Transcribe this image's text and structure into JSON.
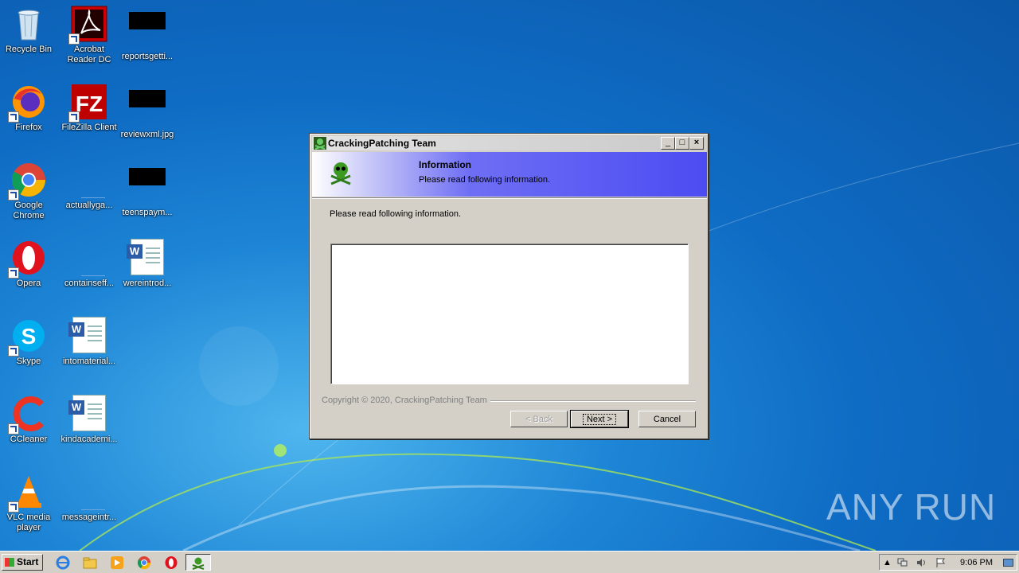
{
  "desktop": {
    "icons": [
      {
        "label": "Recycle Bin"
      },
      {
        "label": "Acrobat Reader DC"
      },
      {
        "label": "reportsgetti..."
      },
      {
        "label": "Firefox"
      },
      {
        "label": "FileZilla Client"
      },
      {
        "label": "reviewxml.jpg"
      },
      {
        "label": "Google Chrome"
      },
      {
        "label": "actuallyga..."
      },
      {
        "label": "teenspaym..."
      },
      {
        "label": "Opera"
      },
      {
        "label": "containseff..."
      },
      {
        "label": "wereintrod..."
      },
      {
        "label": "Skype"
      },
      {
        "label": "intomaterial..."
      },
      {
        "label": "CCleaner"
      },
      {
        "label": "kindacademi..."
      },
      {
        "label": "VLC media player"
      },
      {
        "label": "messageintr..."
      }
    ]
  },
  "dialog": {
    "title": "CrackingPatching Team",
    "header_title": "Information",
    "header_subtitle": "Please read following information.",
    "message": "Please read following information.",
    "copyright": "Copyright © 2020, CrackingPatching Team",
    "back_label": "< Back",
    "next_label": "Next >",
    "cancel_label": "Cancel",
    "minimize_glyph": "_",
    "maximize_glyph": "□",
    "close_glyph": "×"
  },
  "taskbar": {
    "start_label": "Start",
    "clock": "9:06 PM"
  },
  "watermark": "ANY RUN",
  "colors": {
    "banner_blue": "#4c4cf2",
    "desktop_blue": "#1e86d6"
  }
}
